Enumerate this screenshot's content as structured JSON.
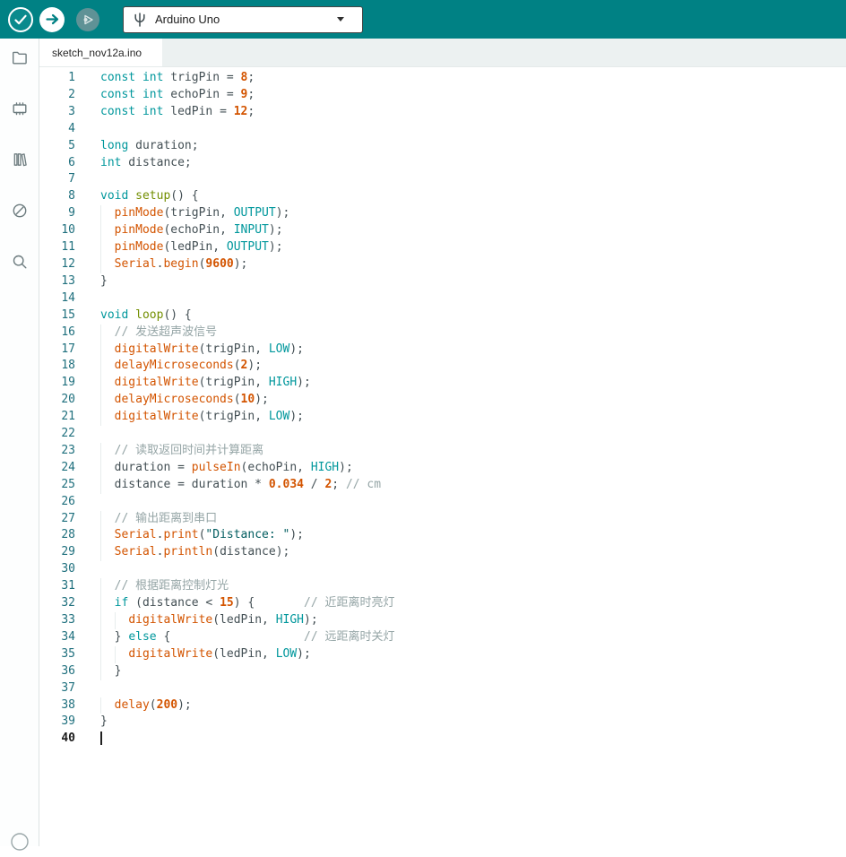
{
  "colors": {
    "toolbar_bg": "#008184",
    "accent": "#008184",
    "tab_bar_bg": "#ECF1F1",
    "editor_bg": "#FFFFFF",
    "gutter_number": "#1E6F7D",
    "token_keyword": "#00979C",
    "token_reserved": "#728E00",
    "token_function": "#D35400",
    "token_number": "#D35400",
    "token_constant": "#00979C",
    "token_string": "#005C5F",
    "token_comment": "#95A5A6",
    "token_plain": "#434F54"
  },
  "toolbar": {
    "board_selector": {
      "label": "Arduino Uno",
      "icon": "board-pinout-icon"
    },
    "buttons": [
      {
        "name": "verify-button",
        "icon": "check-icon"
      },
      {
        "name": "upload-button",
        "icon": "right-arrow-icon"
      },
      {
        "name": "debug-button",
        "icon": "debug-play-icon"
      }
    ]
  },
  "sidebar": {
    "items": [
      {
        "name": "sketchbook",
        "icon": "folder-icon"
      },
      {
        "name": "boards-manager",
        "icon": "chip-icon"
      },
      {
        "name": "library-manager",
        "icon": "books-icon"
      },
      {
        "name": "debugger",
        "icon": "slashed-circle-icon"
      },
      {
        "name": "search",
        "icon": "magnifier-icon"
      },
      {
        "name": "account",
        "icon": "account-circle-icon"
      }
    ]
  },
  "tabs": [
    {
      "label": "sketch_nov12a.ino",
      "active": true
    }
  ],
  "editor": {
    "cursor_line": 40,
    "lines": [
      {
        "n": 1,
        "t": [
          [
            "kw",
            "const"
          ],
          [
            "pl",
            " "
          ],
          [
            "kw",
            "int"
          ],
          [
            "pl",
            " trigPin = "
          ],
          [
            "num",
            "8"
          ],
          [
            "pl",
            ";"
          ]
        ]
      },
      {
        "n": 2,
        "t": [
          [
            "kw",
            "const"
          ],
          [
            "pl",
            " "
          ],
          [
            "kw",
            "int"
          ],
          [
            "pl",
            " echoPin = "
          ],
          [
            "num",
            "9"
          ],
          [
            "pl",
            ";"
          ]
        ]
      },
      {
        "n": 3,
        "t": [
          [
            "kw",
            "const"
          ],
          [
            "pl",
            " "
          ],
          [
            "kw",
            "int"
          ],
          [
            "pl",
            " ledPin = "
          ],
          [
            "num",
            "12"
          ],
          [
            "pl",
            ";"
          ]
        ]
      },
      {
        "n": 4,
        "t": []
      },
      {
        "n": 5,
        "t": [
          [
            "kw",
            "long"
          ],
          [
            "pl",
            " duration;"
          ]
        ]
      },
      {
        "n": 6,
        "t": [
          [
            "kw",
            "int"
          ],
          [
            "pl",
            " distance;"
          ]
        ]
      },
      {
        "n": 7,
        "t": []
      },
      {
        "n": 8,
        "t": [
          [
            "kw",
            "void"
          ],
          [
            "pl",
            " "
          ],
          [
            "fnk",
            "setup"
          ],
          [
            "pl",
            "() {"
          ]
        ]
      },
      {
        "n": 9,
        "t": [
          [
            "pl",
            "  "
          ],
          [
            "fn",
            "pinMode"
          ],
          [
            "pl",
            "(trigPin, "
          ],
          [
            "const",
            "OUTPUT"
          ],
          [
            "pl",
            ");"
          ]
        ]
      },
      {
        "n": 10,
        "t": [
          [
            "pl",
            "  "
          ],
          [
            "fn",
            "pinMode"
          ],
          [
            "pl",
            "(echoPin, "
          ],
          [
            "const",
            "INPUT"
          ],
          [
            "pl",
            ");"
          ]
        ]
      },
      {
        "n": 11,
        "t": [
          [
            "pl",
            "  "
          ],
          [
            "fn",
            "pinMode"
          ],
          [
            "pl",
            "(ledPin, "
          ],
          [
            "const",
            "OUTPUT"
          ],
          [
            "pl",
            ");"
          ]
        ]
      },
      {
        "n": 12,
        "t": [
          [
            "pl",
            "  "
          ],
          [
            "fn",
            "Serial"
          ],
          [
            "pl",
            "."
          ],
          [
            "fn",
            "begin"
          ],
          [
            "pl",
            "("
          ],
          [
            "num",
            "9600"
          ],
          [
            "pl",
            ");"
          ]
        ]
      },
      {
        "n": 13,
        "t": [
          [
            "pl",
            "}"
          ]
        ]
      },
      {
        "n": 14,
        "t": []
      },
      {
        "n": 15,
        "t": [
          [
            "kw",
            "void"
          ],
          [
            "pl",
            " "
          ],
          [
            "fnk",
            "loop"
          ],
          [
            "pl",
            "() {"
          ]
        ]
      },
      {
        "n": 16,
        "t": [
          [
            "pl",
            "  "
          ],
          [
            "com",
            "// 发送超声波信号"
          ]
        ]
      },
      {
        "n": 17,
        "t": [
          [
            "pl",
            "  "
          ],
          [
            "fn",
            "digitalWrite"
          ],
          [
            "pl",
            "(trigPin, "
          ],
          [
            "const",
            "LOW"
          ],
          [
            "pl",
            ");"
          ]
        ]
      },
      {
        "n": 18,
        "t": [
          [
            "pl",
            "  "
          ],
          [
            "fn",
            "delayMicroseconds"
          ],
          [
            "pl",
            "("
          ],
          [
            "num",
            "2"
          ],
          [
            "pl",
            ");"
          ]
        ]
      },
      {
        "n": 19,
        "t": [
          [
            "pl",
            "  "
          ],
          [
            "fn",
            "digitalWrite"
          ],
          [
            "pl",
            "(trigPin, "
          ],
          [
            "const",
            "HIGH"
          ],
          [
            "pl",
            ");"
          ]
        ]
      },
      {
        "n": 20,
        "t": [
          [
            "pl",
            "  "
          ],
          [
            "fn",
            "delayMicroseconds"
          ],
          [
            "pl",
            "("
          ],
          [
            "num",
            "10"
          ],
          [
            "pl",
            ");"
          ]
        ]
      },
      {
        "n": 21,
        "t": [
          [
            "pl",
            "  "
          ],
          [
            "fn",
            "digitalWrite"
          ],
          [
            "pl",
            "(trigPin, "
          ],
          [
            "const",
            "LOW"
          ],
          [
            "pl",
            ");"
          ]
        ]
      },
      {
        "n": 22,
        "t": []
      },
      {
        "n": 23,
        "t": [
          [
            "pl",
            "  "
          ],
          [
            "com",
            "// 读取返回时间并计算距离"
          ]
        ]
      },
      {
        "n": 24,
        "t": [
          [
            "pl",
            "  duration = "
          ],
          [
            "fn",
            "pulseIn"
          ],
          [
            "pl",
            "(echoPin, "
          ],
          [
            "const",
            "HIGH"
          ],
          [
            "pl",
            ");"
          ]
        ]
      },
      {
        "n": 25,
        "t": [
          [
            "pl",
            "  distance = duration * "
          ],
          [
            "num",
            "0.034"
          ],
          [
            "pl",
            " / "
          ],
          [
            "num",
            "2"
          ],
          [
            "pl",
            "; "
          ],
          [
            "com",
            "// cm"
          ]
        ]
      },
      {
        "n": 26,
        "t": []
      },
      {
        "n": 27,
        "t": [
          [
            "pl",
            "  "
          ],
          [
            "com",
            "// 输出距离到串口"
          ]
        ]
      },
      {
        "n": 28,
        "t": [
          [
            "pl",
            "  "
          ],
          [
            "fn",
            "Serial"
          ],
          [
            "pl",
            "."
          ],
          [
            "fn",
            "print"
          ],
          [
            "pl",
            "("
          ],
          [
            "str",
            "\"Distance: \""
          ],
          [
            "pl",
            ");"
          ]
        ]
      },
      {
        "n": 29,
        "t": [
          [
            "pl",
            "  "
          ],
          [
            "fn",
            "Serial"
          ],
          [
            "pl",
            "."
          ],
          [
            "fn",
            "println"
          ],
          [
            "pl",
            "(distance);"
          ]
        ]
      },
      {
        "n": 30,
        "t": []
      },
      {
        "n": 31,
        "t": [
          [
            "pl",
            "  "
          ],
          [
            "com",
            "// 根据距离控制灯光"
          ]
        ]
      },
      {
        "n": 32,
        "t": [
          [
            "pl",
            "  "
          ],
          [
            "kw",
            "if"
          ],
          [
            "pl",
            " (distance < "
          ],
          [
            "num",
            "15"
          ],
          [
            "pl",
            ") {       "
          ],
          [
            "com",
            "// 近距离时亮灯"
          ]
        ]
      },
      {
        "n": 33,
        "t": [
          [
            "pl",
            "    "
          ],
          [
            "fn",
            "digitalWrite"
          ],
          [
            "pl",
            "(ledPin, "
          ],
          [
            "const",
            "HIGH"
          ],
          [
            "pl",
            ");"
          ]
        ]
      },
      {
        "n": 34,
        "t": [
          [
            "pl",
            "  } "
          ],
          [
            "kw",
            "else"
          ],
          [
            "pl",
            " {                   "
          ],
          [
            "com",
            "// 远距离时关灯"
          ]
        ]
      },
      {
        "n": 35,
        "t": [
          [
            "pl",
            "    "
          ],
          [
            "fn",
            "digitalWrite"
          ],
          [
            "pl",
            "(ledPin, "
          ],
          [
            "const",
            "LOW"
          ],
          [
            "pl",
            ");"
          ]
        ]
      },
      {
        "n": 36,
        "t": [
          [
            "pl",
            "  }"
          ]
        ]
      },
      {
        "n": 37,
        "t": []
      },
      {
        "n": 38,
        "t": [
          [
            "pl",
            "  "
          ],
          [
            "fn",
            "delay"
          ],
          [
            "pl",
            "("
          ],
          [
            "num",
            "200"
          ],
          [
            "pl",
            ");"
          ]
        ]
      },
      {
        "n": 39,
        "t": [
          [
            "pl",
            "}"
          ]
        ]
      },
      {
        "n": 40,
        "t": []
      }
    ]
  }
}
